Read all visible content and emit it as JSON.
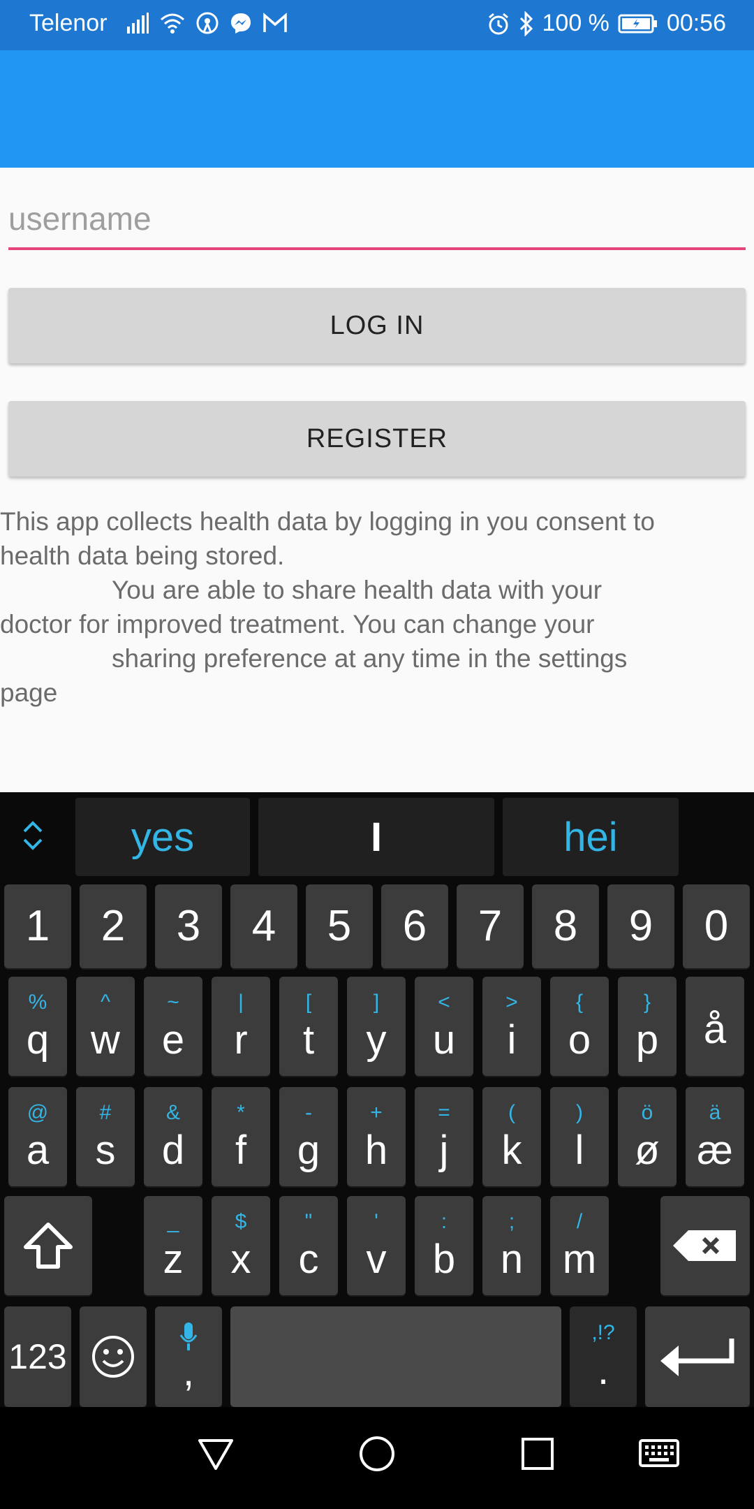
{
  "status_bar": {
    "carrier": "Telenor",
    "battery": "100 %",
    "time": "00:56",
    "icons_left": [
      "signal-icon",
      "wifi-icon",
      "hotspot-icon",
      "messenger-icon",
      "gmail-icon"
    ],
    "icons_right": [
      "alarm-icon",
      "bluetooth-icon",
      "battery-icon"
    ]
  },
  "form": {
    "username_placeholder": "username",
    "login_label": "LOG IN",
    "register_label": "REGISTER"
  },
  "consent": {
    "line1": "This app collects health data by logging in you consent to",
    "line2": "health data being stored.",
    "line3": "You are able to share health data with your",
    "line4": "doctor for improved treatment. You can change your",
    "line5": "sharing preference at any time in the settings",
    "line6": "page"
  },
  "keyboard": {
    "suggestions": [
      "yes",
      "I",
      "hei"
    ],
    "numbers": [
      "1",
      "2",
      "3",
      "4",
      "5",
      "6",
      "7",
      "8",
      "9",
      "0"
    ],
    "row1": [
      {
        "main": "q",
        "alt": "%"
      },
      {
        "main": "w",
        "alt": "^"
      },
      {
        "main": "e",
        "alt": "~"
      },
      {
        "main": "r",
        "alt": "|"
      },
      {
        "main": "t",
        "alt": "["
      },
      {
        "main": "y",
        "alt": "]"
      },
      {
        "main": "u",
        "alt": "<"
      },
      {
        "main": "i",
        "alt": ">"
      },
      {
        "main": "o",
        "alt": "{"
      },
      {
        "main": "p",
        "alt": "}"
      },
      {
        "main": "å",
        "alt": ""
      }
    ],
    "row2": [
      {
        "main": "a",
        "alt": "@"
      },
      {
        "main": "s",
        "alt": "#"
      },
      {
        "main": "d",
        "alt": "&"
      },
      {
        "main": "f",
        "alt": "*"
      },
      {
        "main": "g",
        "alt": "-"
      },
      {
        "main": "h",
        "alt": "+"
      },
      {
        "main": "j",
        "alt": "="
      },
      {
        "main": "k",
        "alt": "("
      },
      {
        "main": "l",
        "alt": ")"
      },
      {
        "main": "ø",
        "alt": "ö"
      },
      {
        "main": "æ",
        "alt": "ä"
      }
    ],
    "row3": [
      {
        "main": "z",
        "alt": "_"
      },
      {
        "main": "x",
        "alt": "$"
      },
      {
        "main": "c",
        "alt": "\""
      },
      {
        "main": "v",
        "alt": "'"
      },
      {
        "main": "b",
        "alt": ":"
      },
      {
        "main": "n",
        "alt": ";"
      },
      {
        "main": "m",
        "alt": "/"
      }
    ],
    "mode_label": "123",
    "comma": ",",
    "period": ".",
    "period_alt": ",!?"
  },
  "nav_bar": {
    "icons": [
      "back-icon",
      "home-icon",
      "recents-icon",
      "keyboard-switch-icon"
    ]
  }
}
